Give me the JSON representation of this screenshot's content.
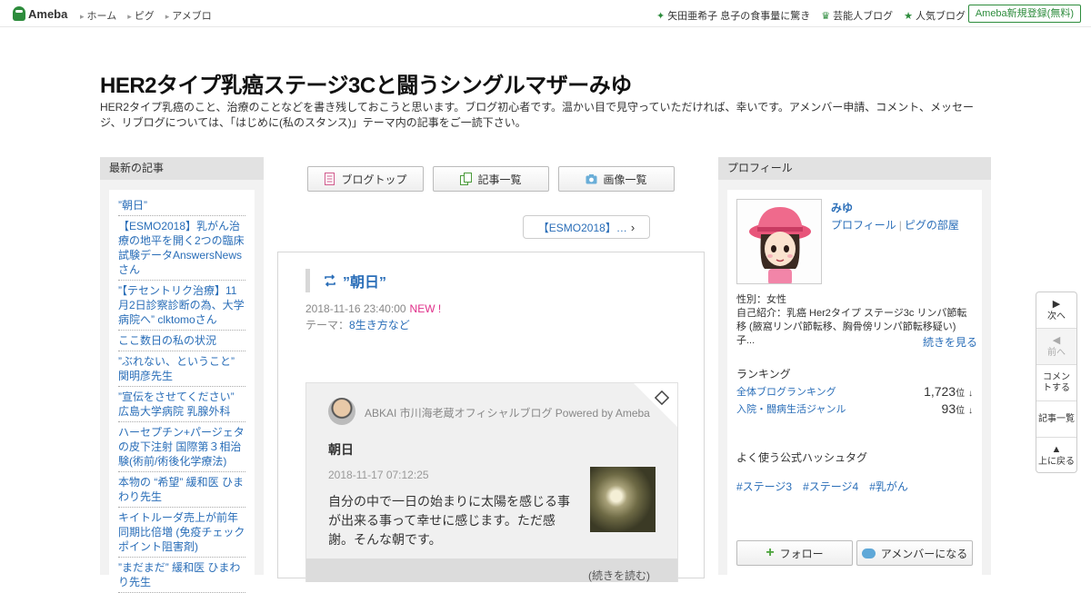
{
  "header": {
    "logo_text": "Ameba",
    "nav": [
      "ホーム",
      "ピグ",
      "アメブロ"
    ],
    "right_links": [
      {
        "icon": "sparkle-icon",
        "label": "矢田亜希子 息子の食事量に驚き"
      },
      {
        "icon": "crown-icon",
        "label": "芸能人ブログ"
      },
      {
        "icon": "star-icon",
        "label": "人気ブログ"
      }
    ],
    "register_label": "Ameba新規登録(無料)"
  },
  "blog": {
    "title": "HER2タイプ乳癌ステージ3Cと闘うシングルマザーみゆ",
    "description": "HER2タイプ乳癌のこと、治療のことなどを書き残しておこうと思います。ブログ初心者です。温かい目で見守っていただければ、幸いです。アメンバー申請、コメント、メッセージ、リブログについては、「はじめに(私のスタンス)」テーマ内の記事をご一読下さい。"
  },
  "left_sidebar": {
    "heading": "最新の記事",
    "items": [
      "”朝日”",
      "【ESMO2018】乳がん治療の地平を開く2つの臨床試験データAnswersNewsさん",
      "”【テセントリク治療】11月2日診察診断の為、大学病院へ” clktomoさん",
      "ここ数日の私の状況",
      "”ぶれない、ということ” 関明彦先生",
      "”宣伝をさせてください” 広島大学病院 乳腺外科",
      "ハーセプチン+パージェタの皮下注射 国際第３相治験(術前/術後化学療法)",
      "本物の “希望” 緩和医 ひまわり先生",
      "キイトルーダ売上が前年同期比倍増 (免疫チェックポイント阻害剤)",
      "”まだまだ” 緩和医 ひまわり先生"
    ]
  },
  "center": {
    "nav_buttons": [
      {
        "icon": "document-icon",
        "label": "ブログトップ"
      },
      {
        "icon": "copy-icon",
        "label": "記事一覧"
      },
      {
        "icon": "camera-icon",
        "label": "画像一覧"
      }
    ],
    "prev_link": "【ESMO2018】…",
    "article": {
      "title": "”朝日”",
      "date": "2018-11-16 23:40:00",
      "new_label": "NEW !",
      "theme_label": "テーマ：",
      "theme": "8生き方など",
      "reblog": {
        "source": "ABKAI 市川海老蔵オフィシャルブログ Powered by Ameba",
        "title": "朝日",
        "date": "2018-11-17 07:12:25",
        "text": "自分の中で一日の始まりに太陽を感じる事が出来る事って幸せに感じます。ただ感謝。そんな朝です。",
        "more": "(続きを読む)"
      }
    }
  },
  "right_sidebar": {
    "heading": "プロフィール",
    "name": "みゆ",
    "links": [
      "プロフィール",
      "ピグの部屋"
    ],
    "gender": "性別：女性",
    "intro": "自己紹介：乳癌 Her2タイプ ステージ3c リンパ節転移 (腋窩リンパ節転移、胸骨傍リンパ節転移疑い) 子...",
    "more_label": "続きを見る",
    "ranking_heading": "ランキング",
    "rankings": [
      {
        "label": "全体ブログランキング",
        "value": "1,723",
        "unit": "位",
        "trend": "↓"
      },
      {
        "label": "入院・闘病生活ジャンル",
        "value": "93",
        "unit": "位",
        "trend": "↓"
      }
    ],
    "hashtag_heading": "よく使う公式ハッシュタグ",
    "hashtags": [
      "#ステージ3",
      "#ステージ4",
      "#乳がん"
    ],
    "follow_label": "フォロー",
    "amember_label": "アメンバーになる"
  },
  "float_nav": [
    {
      "arrow": "▶",
      "label": "次へ",
      "disabled": false
    },
    {
      "arrow": "◀",
      "label": "前へ",
      "disabled": true
    },
    {
      "arrow": "",
      "label": "コメントする",
      "disabled": false
    },
    {
      "arrow": "",
      "label": "記事一覧",
      "disabled": false
    },
    {
      "arrow": "▲",
      "label": "上に戻る",
      "disabled": false
    }
  ],
  "colors": {
    "brand_green": "#2d8c3c",
    "link_blue": "#2a6eb8",
    "new_pink": "#e0308a"
  }
}
